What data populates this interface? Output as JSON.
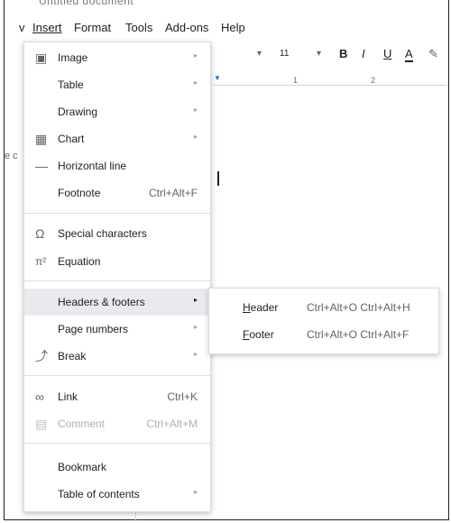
{
  "top_fragment": "Untitled document",
  "menubar": {
    "left_fragment": "v",
    "items": [
      "Insert",
      "Format",
      "Tools",
      "Add-ons",
      "Help"
    ]
  },
  "toolbar": {
    "dropdown_caret_1": "▾",
    "font_size": "11",
    "dropdown_caret_2": "▾",
    "bold": "B",
    "italic": "I",
    "underline": "U",
    "text_color": "A"
  },
  "ruler": {
    "ticks": [
      "1",
      "2"
    ]
  },
  "doc_left_fragment": "e c",
  "insert_menu": {
    "items": [
      {
        "label": "Image",
        "icon": "image-icon",
        "glyph": "▣",
        "has_submenu": true
      },
      {
        "label": "Table",
        "has_submenu": true
      },
      {
        "label": "Drawing",
        "has_submenu": true
      },
      {
        "label": "Chart",
        "icon": "chart-icon",
        "glyph": "▦",
        "has_submenu": true
      },
      {
        "label": "Horizontal line",
        "icon": "horizontal-line-icon",
        "glyph": "—"
      },
      {
        "label": "Footnote",
        "shortcut": "Ctrl+Alt+F"
      },
      {
        "label": "Special characters",
        "icon": "omega-icon",
        "glyph": "Ω"
      },
      {
        "label": "Equation",
        "icon": "pi-icon",
        "glyph": "π²"
      },
      {
        "label": "Headers & footers",
        "has_submenu": true,
        "selected": true
      },
      {
        "label": "Page numbers",
        "has_submenu": true
      },
      {
        "label": "Break",
        "icon": "break-icon",
        "glyph": "⤴",
        "has_submenu": true
      },
      {
        "label": "Link",
        "icon": "link-icon",
        "glyph": "∞",
        "shortcut": "Ctrl+K"
      },
      {
        "label": "Comment",
        "icon": "comment-icon",
        "glyph": "▤",
        "shortcut": "Ctrl+Alt+M",
        "disabled": true
      },
      {
        "label": "Bookmark"
      },
      {
        "label": "Table of contents",
        "has_submenu": true
      }
    ],
    "submenu_arrow": "▸"
  },
  "headers_footers_submenu": {
    "items": [
      {
        "accel": "H",
        "rest": "eader",
        "shortcut": "Ctrl+Alt+O Ctrl+Alt+H"
      },
      {
        "accel": "F",
        "rest": "ooter",
        "shortcut": "Ctrl+Alt+O Ctrl+Alt+F"
      }
    ]
  },
  "colors": {
    "selected_bg": "#e8eaed",
    "disabled_text": "#b0b0b0",
    "ruler_marker": "#1a73e8"
  }
}
